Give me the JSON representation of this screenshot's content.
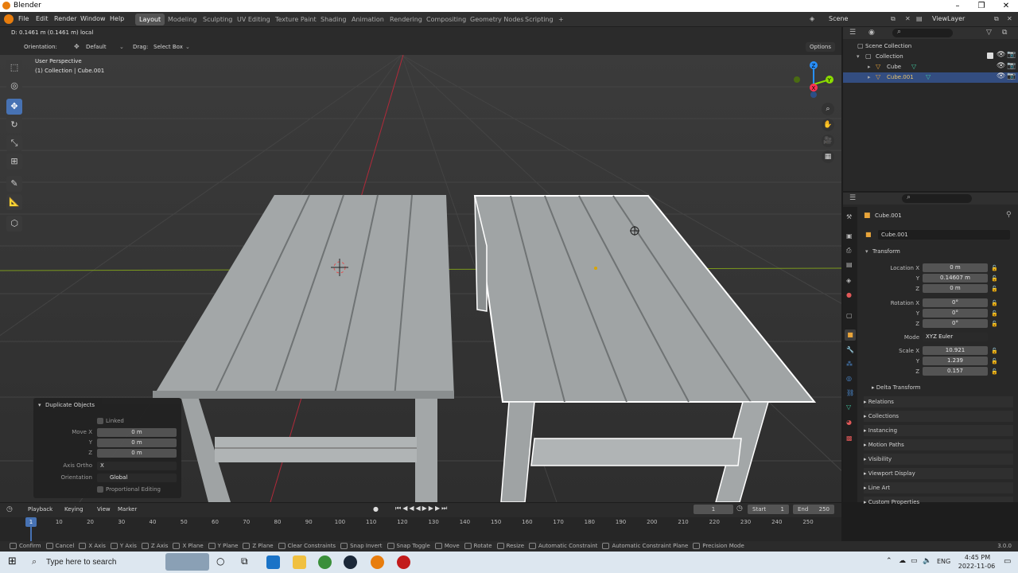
{
  "window": {
    "title": "Blender"
  },
  "menu": [
    "File",
    "Edit",
    "Render",
    "Window",
    "Help"
  ],
  "workspaces": [
    "Layout",
    "Modeling",
    "Sculpting",
    "UV Editing",
    "Texture Paint",
    "Shading",
    "Animation",
    "Rendering",
    "Compositing",
    "Geometry Nodes",
    "Scripting",
    "+"
  ],
  "scene": {
    "label": "Scene",
    "viewlayer": "ViewLayer"
  },
  "viewport": {
    "header_info": "D: 0.1461 m (0.1461 m) local",
    "orientation_label": "Orientation:",
    "orientation_value": "Default",
    "drag_label": "Drag:",
    "drag_value": "Select Box",
    "options_label": "Options",
    "view_name": "User Perspective",
    "collection_info": "(1) Collection | Cube.001"
  },
  "gizmo": {
    "axes": [
      "Z",
      "Y",
      "X"
    ]
  },
  "operator_panel": {
    "title": "Duplicate Objects",
    "linked_label": "Linked",
    "move_x_label": "Move X",
    "move_x": "0 m",
    "y_label": "Y",
    "y": "0 m",
    "z_label": "Z",
    "z": "0 m",
    "axis_ortho_label": "Axis Ortho",
    "axis_ortho": "X",
    "orientation_label": "Orientation",
    "orientation": "Global",
    "proportional_label": "Proportional Editing"
  },
  "outliner": {
    "root": "Scene Collection",
    "collection": "Collection",
    "items": [
      "Cube",
      "Cube.001"
    ]
  },
  "properties": {
    "object_name": "Cube.001",
    "object_field": "Cube.001",
    "transform_title": "Transform",
    "location_label": "Location X",
    "location": [
      "0 m",
      "0.14607 m",
      "0 m"
    ],
    "rotation_label": "Rotation X",
    "rotation": [
      "0°",
      "0°",
      "0°"
    ],
    "mode_label": "Mode",
    "mode": "XYZ Euler",
    "scale_label": "Scale X",
    "scale": [
      "10.921",
      "1.239",
      "0.157"
    ],
    "y_label": "Y",
    "z_label": "Z",
    "delta_transform": "Delta Transform",
    "panels": [
      "Relations",
      "Collections",
      "Instancing",
      "Motion Paths",
      "Visibility",
      "Viewport Display",
      "Line Art",
      "Custom Properties"
    ]
  },
  "timeline": {
    "menu": [
      "Playback",
      "Keying",
      "View",
      "Marker"
    ],
    "current_frame": "1",
    "start_label": "Start",
    "start": "1",
    "end_label": "End",
    "end": "250",
    "ticks": [
      "1",
      "10",
      "20",
      "30",
      "40",
      "50",
      "60",
      "70",
      "80",
      "90",
      "100",
      "110",
      "120",
      "130",
      "140",
      "150",
      "160",
      "170",
      "180",
      "190",
      "200",
      "210",
      "220",
      "230",
      "240",
      "250"
    ]
  },
  "statusbar": {
    "items": [
      "Confirm",
      "Cancel",
      "X Axis",
      "Y Axis",
      "Z Axis",
      "X Plane",
      "Y Plane",
      "Z Plane",
      "Clear Constraints",
      "Snap Invert",
      "Snap Toggle",
      "Move",
      "Rotate",
      "Resize",
      "Automatic Constraint",
      "Automatic Constraint Plane",
      "Precision Mode"
    ],
    "version": "3.0.0"
  },
  "taskbar": {
    "search_placeholder": "Type here to search",
    "lang": "ENG",
    "time": "4:45 PM",
    "date": "2022-11-06"
  },
  "colors": {
    "accent": "#4772b3",
    "selected_outline": "#ffffff",
    "x_axis": "#ff3352",
    "y_axis": "#8bdc00",
    "z_axis": "#2890ff"
  }
}
